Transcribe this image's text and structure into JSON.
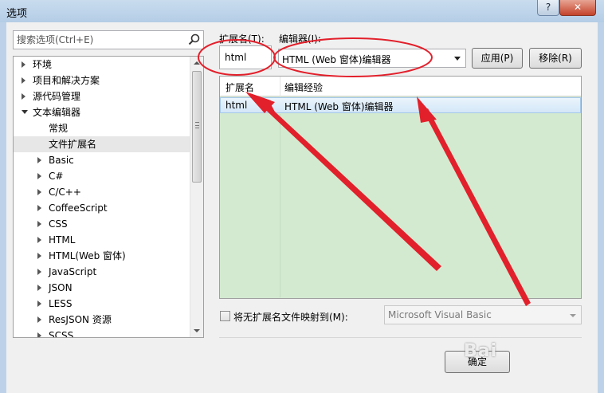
{
  "window": {
    "title": "选项",
    "help_label": "?",
    "close_label": "✕"
  },
  "search": {
    "placeholder": "搜索选项(Ctrl+E)"
  },
  "tree": {
    "items": [
      {
        "label": "环境",
        "level": 0,
        "expander": "collapsed"
      },
      {
        "label": "项目和解决方案",
        "level": 0,
        "expander": "collapsed"
      },
      {
        "label": "源代码管理",
        "level": 0,
        "expander": "collapsed"
      },
      {
        "label": "文本编辑器",
        "level": 0,
        "expander": "expanded"
      },
      {
        "label": "常规",
        "level": 1,
        "expander": "none"
      },
      {
        "label": "文件扩展名",
        "level": 1,
        "expander": "none",
        "selected": true
      },
      {
        "label": "Basic",
        "level": 1,
        "expander": "collapsed"
      },
      {
        "label": "C#",
        "level": 1,
        "expander": "collapsed"
      },
      {
        "label": "C/C++",
        "level": 1,
        "expander": "collapsed"
      },
      {
        "label": "CoffeeScript",
        "level": 1,
        "expander": "collapsed"
      },
      {
        "label": "CSS",
        "level": 1,
        "expander": "collapsed"
      },
      {
        "label": "HTML",
        "level": 1,
        "expander": "collapsed"
      },
      {
        "label": "HTML(Web 窗体)",
        "level": 1,
        "expander": "collapsed"
      },
      {
        "label": "JavaScript",
        "level": 1,
        "expander": "collapsed"
      },
      {
        "label": "JSON",
        "level": 1,
        "expander": "collapsed"
      },
      {
        "label": "LESS",
        "level": 1,
        "expander": "collapsed"
      },
      {
        "label": "ResJSON 资源",
        "level": 1,
        "expander": "collapsed"
      },
      {
        "label": "SCSS",
        "level": 1,
        "expander": "collapsed"
      }
    ]
  },
  "form": {
    "extension_label": "扩展名(T):",
    "extension_value": "html",
    "editor_label": "编辑器(I):",
    "editor_value": "HTML (Web 窗体)编辑器",
    "apply_label": "应用(P)",
    "remove_label": "移除(R)"
  },
  "list": {
    "columns": [
      "扩展名",
      "编辑经验"
    ],
    "rows": [
      {
        "extension": "html",
        "editor": "HTML (Web 窗体)编辑器"
      }
    ]
  },
  "mapping": {
    "checkbox_label": "将无扩展名文件映射到(M):",
    "checked": false,
    "select_value": "Microsoft Visual Basic"
  },
  "footer": {
    "ok_label": "确定"
  },
  "watermark": {
    "text": "Bai"
  },
  "colors": {
    "annotation_red": "#e2202b",
    "list_background": "#d3ead0",
    "selected_row": "#d4e7f8"
  }
}
